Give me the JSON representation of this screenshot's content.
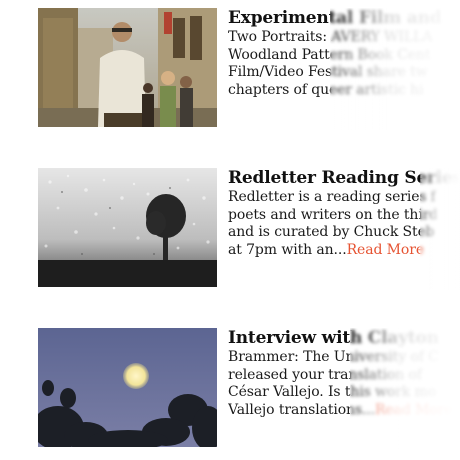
{
  "posts": [
    {
      "title": "Experimental Film and",
      "excerpt_lines": [
        "Two Portraits: AVERY WILLA",
        "Woodland Pattern Book Cent",
        "Film/Video Festival share tw",
        "chapters of queer artistic hi"
      ],
      "read_more": "",
      "image_icon": "street-photo-icon"
    },
    {
      "title": "Redletter Reading Series",
      "excerpt_lines": [
        "Redletter is a reading series f",
        "poets and writers on the third",
        "and is curated by Chuck Steb",
        "at 7pm with an..."
      ],
      "read_more": "Read More",
      "image_icon": "rain-window-icon"
    },
    {
      "title": "Interview with Clayton",
      "excerpt_lines": [
        "Brammer: The University of C",
        "released your translation of ",
        "César Vallejo. Is this work mo",
        "Vallejo translations..."
      ],
      "read_more": "Read More",
      "image_icon": "moon-photo-icon"
    }
  ],
  "colors": {
    "link": "#e65332",
    "text": "#141414"
  }
}
